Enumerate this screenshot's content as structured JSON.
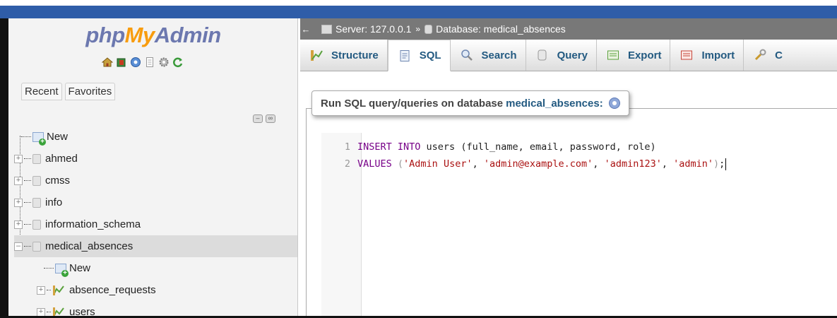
{
  "brand": {
    "php": "php",
    "my": "My",
    "admin": "Admin"
  },
  "nav": {
    "icons": [
      "home-icon",
      "exit-icon",
      "query-window-icon",
      "docs-icon",
      "settings-icon",
      "reload-icon"
    ],
    "tabs": [
      "Recent",
      "Favorites"
    ],
    "tree": {
      "new_label": "New",
      "databases": [
        {
          "name": "ahmed"
        },
        {
          "name": "cmss"
        },
        {
          "name": "info"
        },
        {
          "name": "information_schema"
        },
        {
          "name": "medical_absences",
          "expanded": true,
          "selected": true
        }
      ],
      "child_new_label": "New",
      "tables": [
        "absence_requests",
        "users"
      ]
    }
  },
  "breadcrumb": {
    "server": "Server: 127.0.0.1",
    "separator": "»",
    "database": "Database: medical_absences"
  },
  "tabs": [
    {
      "label": "Structure",
      "icon": "structure-icon"
    },
    {
      "label": "SQL",
      "icon": "sql-icon",
      "active": true
    },
    {
      "label": "Search",
      "icon": "search-icon"
    },
    {
      "label": "Query",
      "icon": "query-icon"
    },
    {
      "label": "Export",
      "icon": "export-icon"
    },
    {
      "label": "Import",
      "icon": "import-icon"
    },
    {
      "label": "C",
      "icon": "operations-icon"
    }
  ],
  "sql_panel": {
    "legend": "Run SQL query/queries on database",
    "database": "medical_absences:"
  },
  "editor": {
    "lines": [
      {
        "num": "1",
        "kw": "INSERT INTO",
        "rest": " users ",
        "args": "(full_name, email, password, role)"
      },
      {
        "num": "2",
        "kw": "VALUES",
        "values": [
          "'Admin User'",
          "'admin@example.com'",
          "'admin123'",
          "'admin'"
        ]
      }
    ]
  }
}
